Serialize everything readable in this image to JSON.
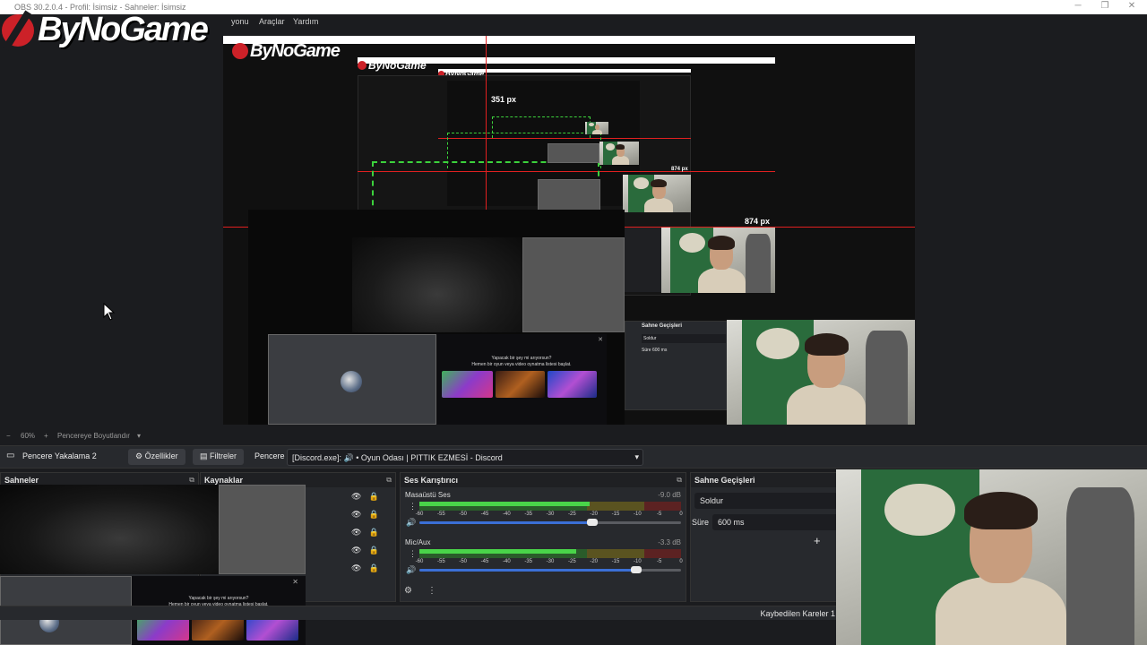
{
  "window": {
    "title": "OBS 30.2.0.4 - Profil: İsimsiz - Sahneler: İsimsiz",
    "title_visible": "Profil: İsimsiz - Sahneler: İsimsiz"
  },
  "menu": {
    "items": [
      "yonu",
      "Araçlar",
      "Yardım"
    ]
  },
  "logo": {
    "text": "ByNoGame"
  },
  "preview": {
    "measure_top": "351 px",
    "measure_right": "874 px",
    "measure_right_small": "874 px",
    "discord_title": "Yapacak bir şey mi arıyorsun?",
    "discord_sub": "Hemen bir oyun veya video oynatma listesi başlat."
  },
  "zoom": {
    "minus": "−",
    "percent": "60%",
    "plus": "+",
    "fit_label": "Pencereye Boyutlandır",
    "caret": "▾"
  },
  "context_bar": {
    "source_name": "Pencere Yakalama 2",
    "properties_label": "Özellikler",
    "filters_label": "Filtreler",
    "window_label": "Pencere",
    "window_value": "[Discord.exe]: 🔊 • Oyun Odası | PITTIK EZMESİ - Discord"
  },
  "docks": {
    "scenes": {
      "title": "Sahneler"
    },
    "sources": {
      "title": "Kaynaklar"
    },
    "mixer": {
      "title": "Ses Karıştırıcı",
      "channels": [
        {
          "name": "Masaüstü Ses",
          "db": "-9.0 dB",
          "level": 0.65,
          "volume": 0.66
        },
        {
          "name": "Mic/Aux",
          "db": "-3.3 dB",
          "level": 0.6,
          "volume": 0.83
        }
      ],
      "ticks": [
        "-60",
        "-55",
        "-50",
        "-45",
        "-40",
        "-35",
        "-30",
        "-25",
        "-20",
        "-15",
        "-10",
        "-5",
        "0"
      ]
    },
    "transitions": {
      "title": "Sahne Geçişleri",
      "type": "Soldur",
      "duration_label": "Süre",
      "duration_value": "600 ms",
      "add": "+"
    }
  },
  "status": {
    "dropped_frames": "Kaybedilen Kareler 1"
  },
  "colors": {
    "accent_red": "#e02020",
    "guide_green": "#3cd23c",
    "slider_blue": "#3b6fd6"
  }
}
